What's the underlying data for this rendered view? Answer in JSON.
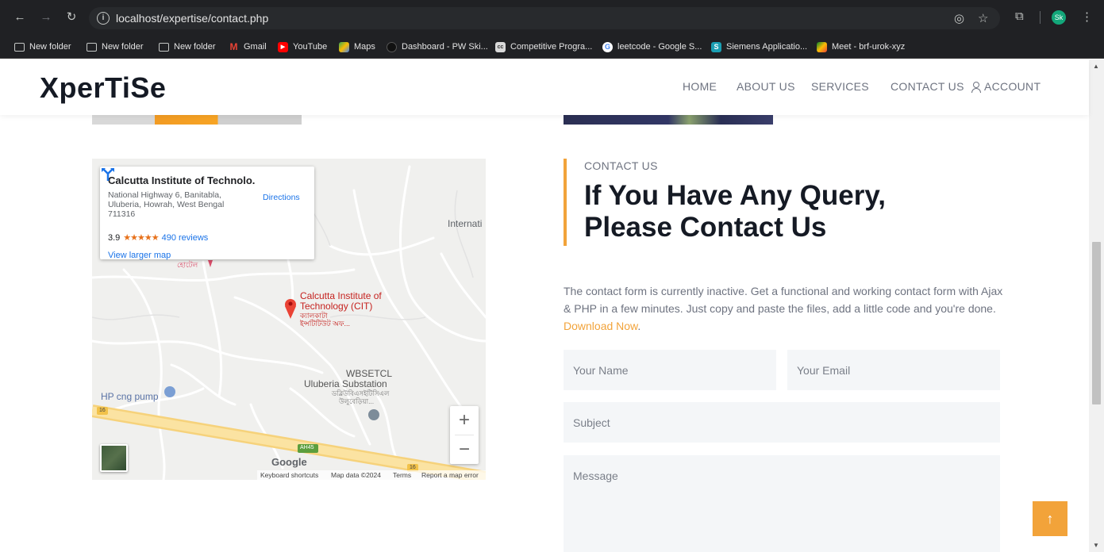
{
  "browser": {
    "url": "localhost/expertise/contact.php",
    "profile_initials": "Sk",
    "bookmarks": [
      {
        "label": "New folder",
        "kind": "folder"
      },
      {
        "label": "New folder",
        "kind": "folder"
      },
      {
        "label": "New folder",
        "kind": "folder"
      },
      {
        "label": "Gmail",
        "kind": "gmail"
      },
      {
        "label": "YouTube",
        "kind": "youtube"
      },
      {
        "label": "Maps",
        "kind": "maps"
      },
      {
        "label": "Dashboard - PW Ski...",
        "kind": "pw"
      },
      {
        "label": "Competitive Progra...",
        "kind": "cc"
      },
      {
        "label": "leetcode - Google S...",
        "kind": "google"
      },
      {
        "label": "Siemens Applicatio...",
        "kind": "siemens"
      },
      {
        "label": "Meet - brf-urok-xyz",
        "kind": "meet"
      }
    ]
  },
  "site": {
    "logo": "XperTiSe",
    "nav": {
      "home": "HOME",
      "about": "ABOUT US",
      "services": "SERVICES",
      "contact": "CONTACT US",
      "account": "ACCOUNT"
    }
  },
  "map": {
    "place_title": "Calcutta Institute of Technolo...",
    "address": "National Highway 6, Banitabla, Uluberia, Howrah, West Bengal 711316",
    "rating": "3.9",
    "stars": "★★★★★",
    "reviews": "490 reviews",
    "view_larger": "View larger map",
    "directions": "Directions",
    "labels": {
      "international": "Internati",
      "hotel_bn": "হোটেল",
      "pin_line1": "Calcutta Institute of",
      "pin_line2": "Technology (CIT)",
      "pin_bn1": "ক্যালকাটা",
      "pin_bn2": "ইন্সটিটিউট অফ...",
      "wbsetcl1": "WBSETCL",
      "wbsetcl2": "Uluberia Substation",
      "wbsetcl_bn1": "ডব্লিউবিএসইটিসিএল",
      "wbsetcl_bn2": "উলুবেড়িয়া...",
      "hp": "HP cng pump",
      "road16": "16",
      "ah45": "AH45",
      "road16b": "16"
    },
    "google": "Google",
    "footer": {
      "shortcuts": "Keyboard shortcuts",
      "data": "Map data ©2024",
      "terms": "Terms",
      "report": "Report a map error"
    },
    "zoom_in": "+",
    "zoom_out": "−"
  },
  "contact": {
    "eyebrow": "CONTACT US",
    "heading_line1": "If You Have Any Query,",
    "heading_line2": "Please Contact Us",
    "description": "The contact form is currently inactive. Get a functional and working contact form with Ajax & PHP in a few minutes. Just copy and paste the files, add a little code and you're done.",
    "download_link": "Download Now",
    "period": ".",
    "form": {
      "name_placeholder": "Your Name",
      "email_placeholder": "Your Email",
      "subject_placeholder": "Subject",
      "message_placeholder": "Message"
    }
  },
  "back_to_top": "↑"
}
